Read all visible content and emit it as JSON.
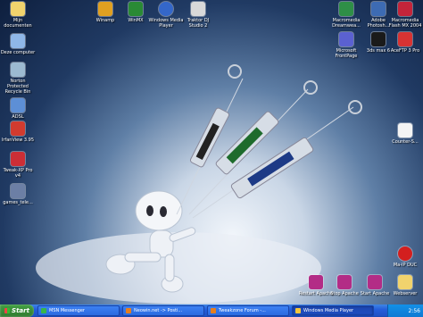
{
  "desktop_icons": {
    "mijn_documenten": "Mijn documenten",
    "deze_computer": "Deze computer",
    "norton": "Norton Protected Recycle Bin",
    "adsl": "ADSL",
    "irfanview": "IrfanView 3.95",
    "tweakxp": "Tweak-XP Pro v4",
    "games": "games_tele...",
    "winamp": "Winamp",
    "winmx": "WinMX",
    "wmp": "Windows Media Player",
    "traktor": "Traktor DJ Studio 2",
    "dreamweaver": "Macromedia Dreamwea...",
    "photoshop": "Adobe Photosh...",
    "flashmx": "Macromedia Flash MX 2004",
    "frontpage": "Microsoft FrontPage",
    "max": "3ds max 6",
    "aceftp": "AceFTP 3 Pro",
    "counterstrike": "Counter-S...",
    "mirc": "Ma-IP DUC",
    "restart_apache": "Restart Apache",
    "stop_apache": "Stop Apache",
    "start_apache": "Start Apache",
    "webserver": "Webserver"
  },
  "taskbar": {
    "start_label": "Start",
    "tasks": [
      "MSN Messenger",
      "Neowin.net -> Posti...",
      "Tweakzone Forum -...",
      "Windows Media Player"
    ],
    "clock": "2:56"
  },
  "colors": {
    "taskbar_blue": "#245edb",
    "start_green": "#3a8d3a",
    "tray_blue": "#0f7ad3"
  }
}
